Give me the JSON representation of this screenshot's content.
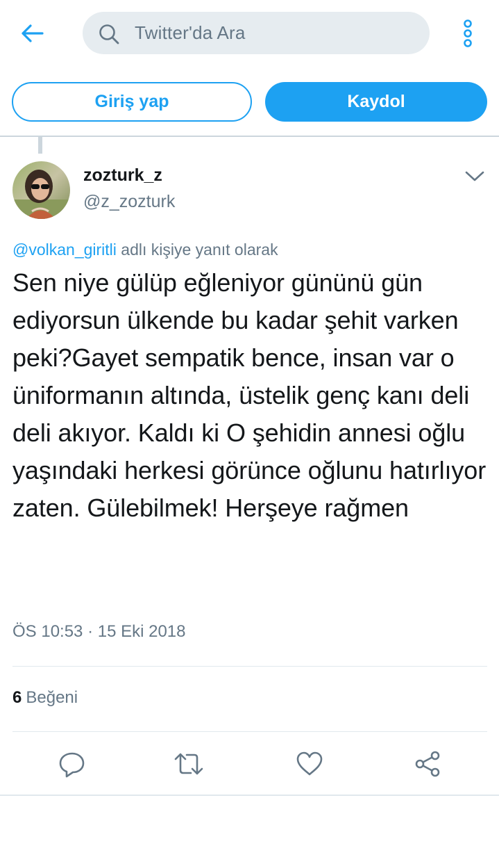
{
  "header": {
    "search_placeholder": "Twitter'da Ara",
    "back_icon": "arrow-left-icon",
    "more_icon": "vertical-dots-icon"
  },
  "auth": {
    "login_label": "Giriş yap",
    "signup_label": "Kaydol"
  },
  "tweet": {
    "author_name": "zozturk_z",
    "author_handle": "@z_zozturk",
    "reply_to_mention": "@volkan_giritli",
    "reply_to_suffix": " adlı kişiye yanıt olarak",
    "text": "Sen niye gülüp eğleniyor gününü gün ediyorsun ülkende bu kadar şehit varken peki?Gayet sempatik bence, insan var o üniformanın altında, üstelik genç kanı deli deli akıyor. Kaldı ki O şehidin annesi oğlu yaşındaki herkesi görünce oğlunu hatırlıyor zaten. Gülebilmek! Herşeye rağmen",
    "timestamp": "ÖS 10:53 · 15 Eki 2018",
    "likes_count": "6",
    "likes_label": "Beğeni"
  },
  "actions": [
    "reply-icon",
    "retweet-icon",
    "like-icon",
    "share-icon"
  ],
  "colors": {
    "accent": "#1da1f2",
    "text": "#14171a",
    "secondary_text": "#657786",
    "search_bg": "#e6ecf0",
    "divider": "#e1e8ed"
  }
}
